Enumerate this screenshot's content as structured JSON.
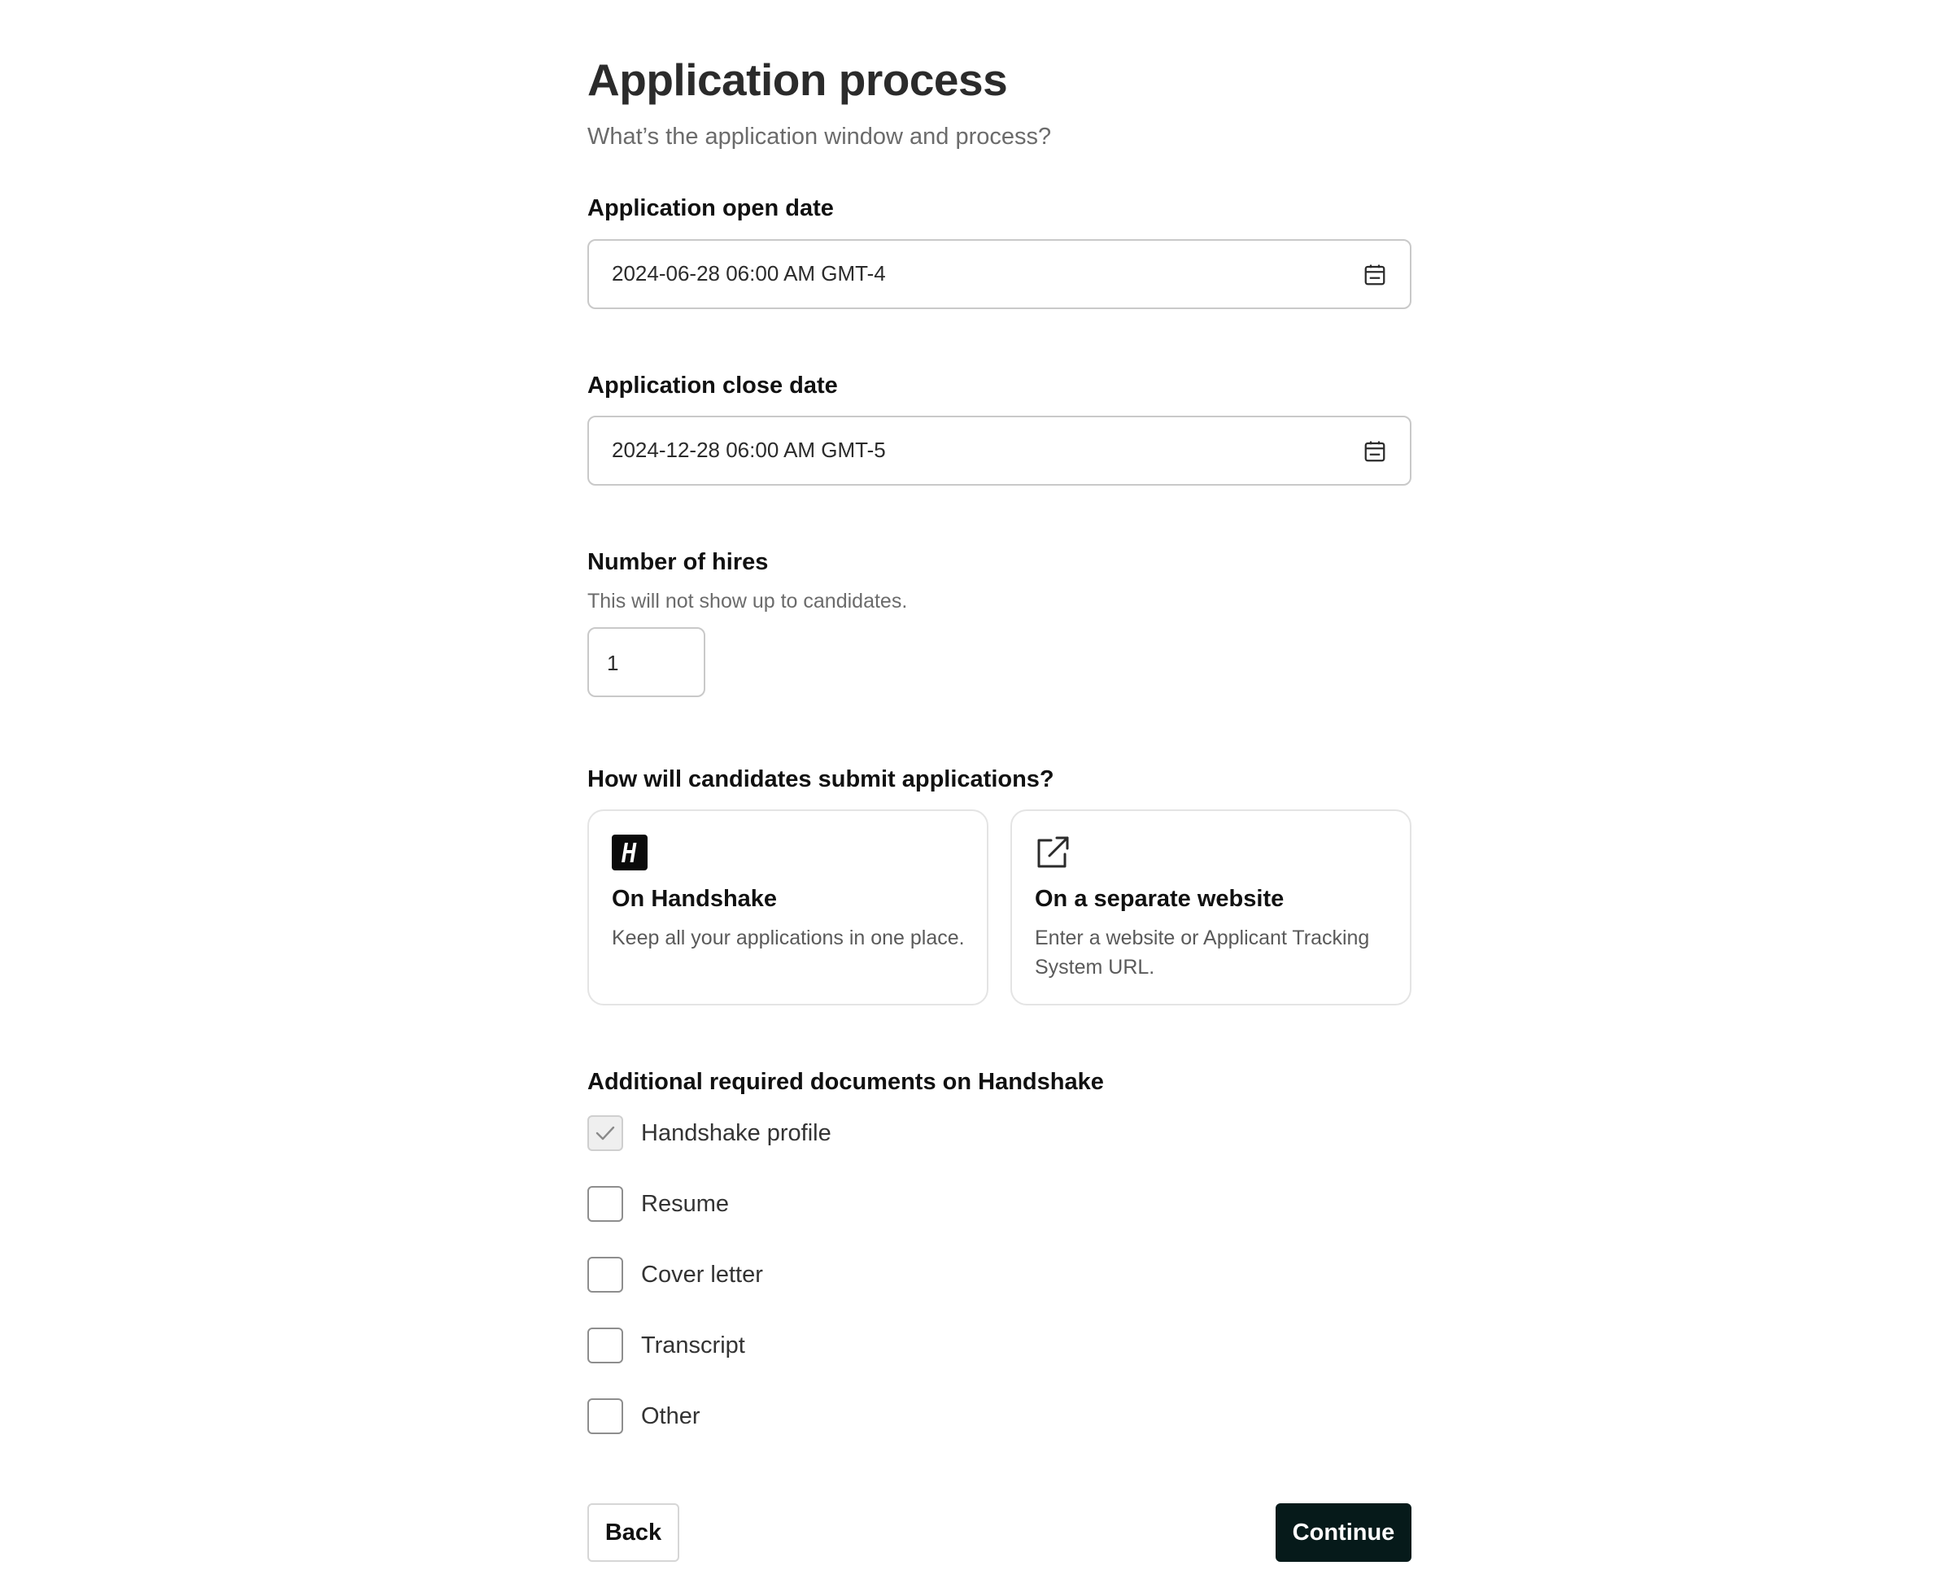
{
  "header": {
    "title": "Application process",
    "subtitle": "What’s the application window and process?"
  },
  "open_date": {
    "label": "Application open date",
    "value": "2024-06-28 06:00 AM GMT-4",
    "icon": "calendar-icon"
  },
  "close_date": {
    "label": "Application close date",
    "value": "2024-12-28 06:00 AM GMT-5",
    "icon": "calendar-icon"
  },
  "hires": {
    "label": "Number of hires",
    "hint": "This will not show up to candidates.",
    "value": "1"
  },
  "submission": {
    "label": "How will candidates submit applications?",
    "options": [
      {
        "title": "On Handshake",
        "description": "Keep all your applications in one place.",
        "icon": "handshake-logo-icon"
      },
      {
        "title": "On a separate website",
        "description": "Enter a website or Applicant Tracking System URL.",
        "icon": "external-link-icon"
      }
    ]
  },
  "documents": {
    "label": "Additional required documents on Handshake",
    "items": [
      {
        "label": "Handshake profile",
        "checked": true,
        "disabled": true
      },
      {
        "label": "Resume",
        "checked": false
      },
      {
        "label": "Cover letter",
        "checked": false
      },
      {
        "label": "Transcript",
        "checked": false
      },
      {
        "label": "Other",
        "checked": false
      }
    ]
  },
  "actions": {
    "back_label": "Back",
    "continue_label": "Continue"
  },
  "colors": {
    "primary_button": "#061a1a",
    "border": "#c9c9c9",
    "muted_text": "#6b6b6b"
  }
}
